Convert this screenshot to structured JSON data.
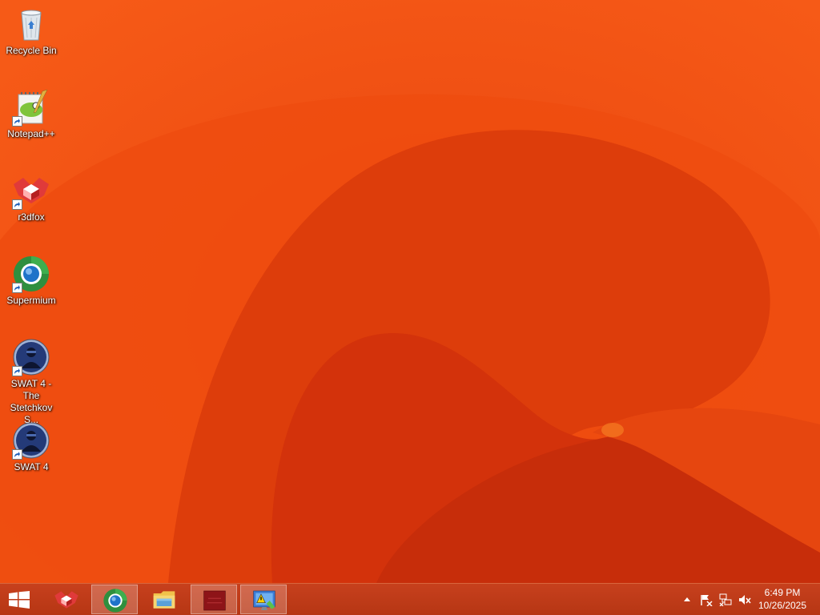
{
  "desktop": {
    "icons": [
      {
        "label": "Recycle Bin",
        "icon": "recycle-bin-icon"
      },
      {
        "label": "Notepad++",
        "icon": "notepad-plus-plus-icon"
      },
      {
        "label": "r3dfox",
        "icon": "r3dfox-icon"
      },
      {
        "label": "Supermium",
        "icon": "supermium-icon"
      },
      {
        "label": "SWAT 4 - The Stetchkov S...",
        "icon": "swat4-stetchkov-icon"
      },
      {
        "label": "SWAT 4",
        "icon": "swat4-icon"
      }
    ]
  },
  "taskbar": {
    "buttons": [
      {
        "icon": "windows-start-icon"
      },
      {
        "icon": "r3dfox-icon"
      },
      {
        "icon": "supermium-icon",
        "active": true
      },
      {
        "icon": "file-explorer-icon"
      },
      {
        "icon": "wallpaper-thumbnail-icon",
        "active": true
      },
      {
        "icon": "action-center-icon",
        "active": true
      }
    ],
    "tray": {
      "icons": [
        "show-hidden-icons-chevron",
        "action-center-flag-icon",
        "network-icon",
        "volume-muted-icon"
      ],
      "time": "6:49 PM",
      "date": "10/26/2025"
    }
  },
  "colors": {
    "wallpaper_base": "#f24f12",
    "wallpaper_dark": "#c72d0a",
    "taskbar": "#c03a17"
  }
}
